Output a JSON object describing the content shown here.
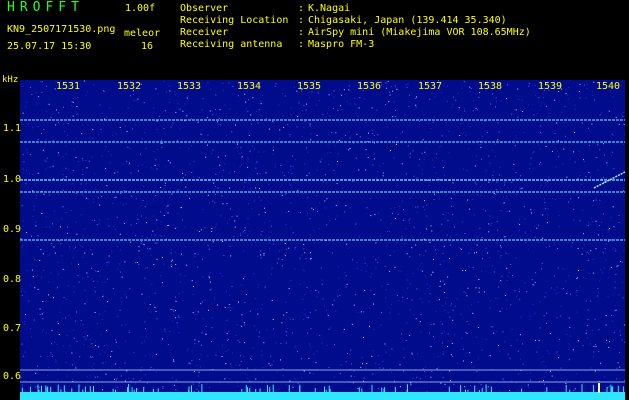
{
  "header": {
    "app_name": "HROFFT",
    "version": "1.00f",
    "filename": "KN9_2507171530.png",
    "timestamp": "25.07.17 15:30",
    "mode": "meleor",
    "count": "16"
  },
  "info": [
    {
      "label": "Observer",
      "value": "K.Nagai"
    },
    {
      "label": "Receiving Location",
      "value": "Chigasaki, Japan (139.414 35.340)"
    },
    {
      "label": "Receiver",
      "value": "AirSpy mini (Miakejima VOR 108.65MHz)"
    },
    {
      "label": "Receiving antenna",
      "value": "Maspro FM-3"
    }
  ],
  "separator": ":",
  "axis": {
    "unit": "kHz",
    "y_ticks": [
      "1.1",
      "1.0",
      "0.9",
      "0.8",
      "0.7",
      "0.6"
    ],
    "x_ticks": [
      "1531",
      "1532",
      "1533",
      "1534",
      "1535",
      "1536",
      "1537",
      "1538",
      "1539",
      "1540"
    ]
  },
  "colors": {
    "background": "#000c8c",
    "label_yellow": "#ffff00",
    "title_green": "#22ff22",
    "signal_cyan": "#70e8ff"
  }
}
